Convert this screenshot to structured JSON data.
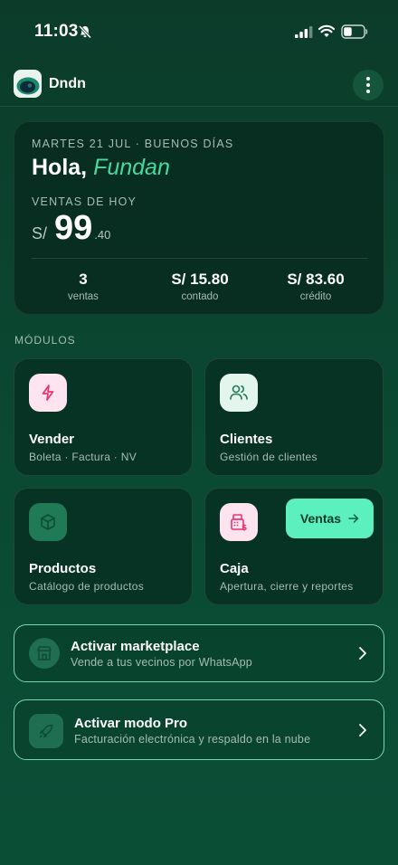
{
  "status_bar": {
    "time": "11:03"
  },
  "app": {
    "name": "Dndn"
  },
  "summary": {
    "date_line": "MARTES 21 JUL · BUENOS DÍAS",
    "greeting": "Hola,",
    "user_name": "Fundan",
    "sales_label": "VENTAS DE HOY",
    "currency": "S/",
    "amount_int": "99",
    "amount_dec": ".40",
    "stats": [
      {
        "value": "3",
        "label": "ventas"
      },
      {
        "value": "S/ 15.80",
        "label": "contado"
      },
      {
        "value": "S/ 83.60",
        "label": "crédito"
      }
    ]
  },
  "modules_label": "MÓDULOS",
  "modules": [
    {
      "title": "Vender",
      "subtitle": "Boleta · Factura · NV",
      "icon": "lightning-icon"
    },
    {
      "title": "Clientes",
      "subtitle": "Gestión de clientes",
      "icon": "users-icon"
    },
    {
      "title": "Productos",
      "subtitle": "Catálogo de productos",
      "icon": "box-icon"
    },
    {
      "title": "Caja",
      "subtitle": "Apertura, cierre y reportes",
      "icon": "cash-register-icon",
      "action_label": "Ventas"
    }
  ],
  "banners": [
    {
      "title": "Activar marketplace",
      "subtitle": "Vende a tus vecinos por WhatsApp",
      "icon": "store-icon"
    },
    {
      "title": "Activar modo Pro",
      "subtitle": "Facturación electrónica y respaldo en la nube",
      "icon": "rocket-icon"
    }
  ],
  "colors": {
    "background": "#0b4a33",
    "card": "#073324",
    "accent": "#5cf0be",
    "accent_text": "#49d9a0",
    "pink_icon_bg": "#fde4ee",
    "pink_icon": "#e8336f",
    "mint_icon_bg": "#e3f5ec",
    "mint_icon": "#1f7a55"
  }
}
